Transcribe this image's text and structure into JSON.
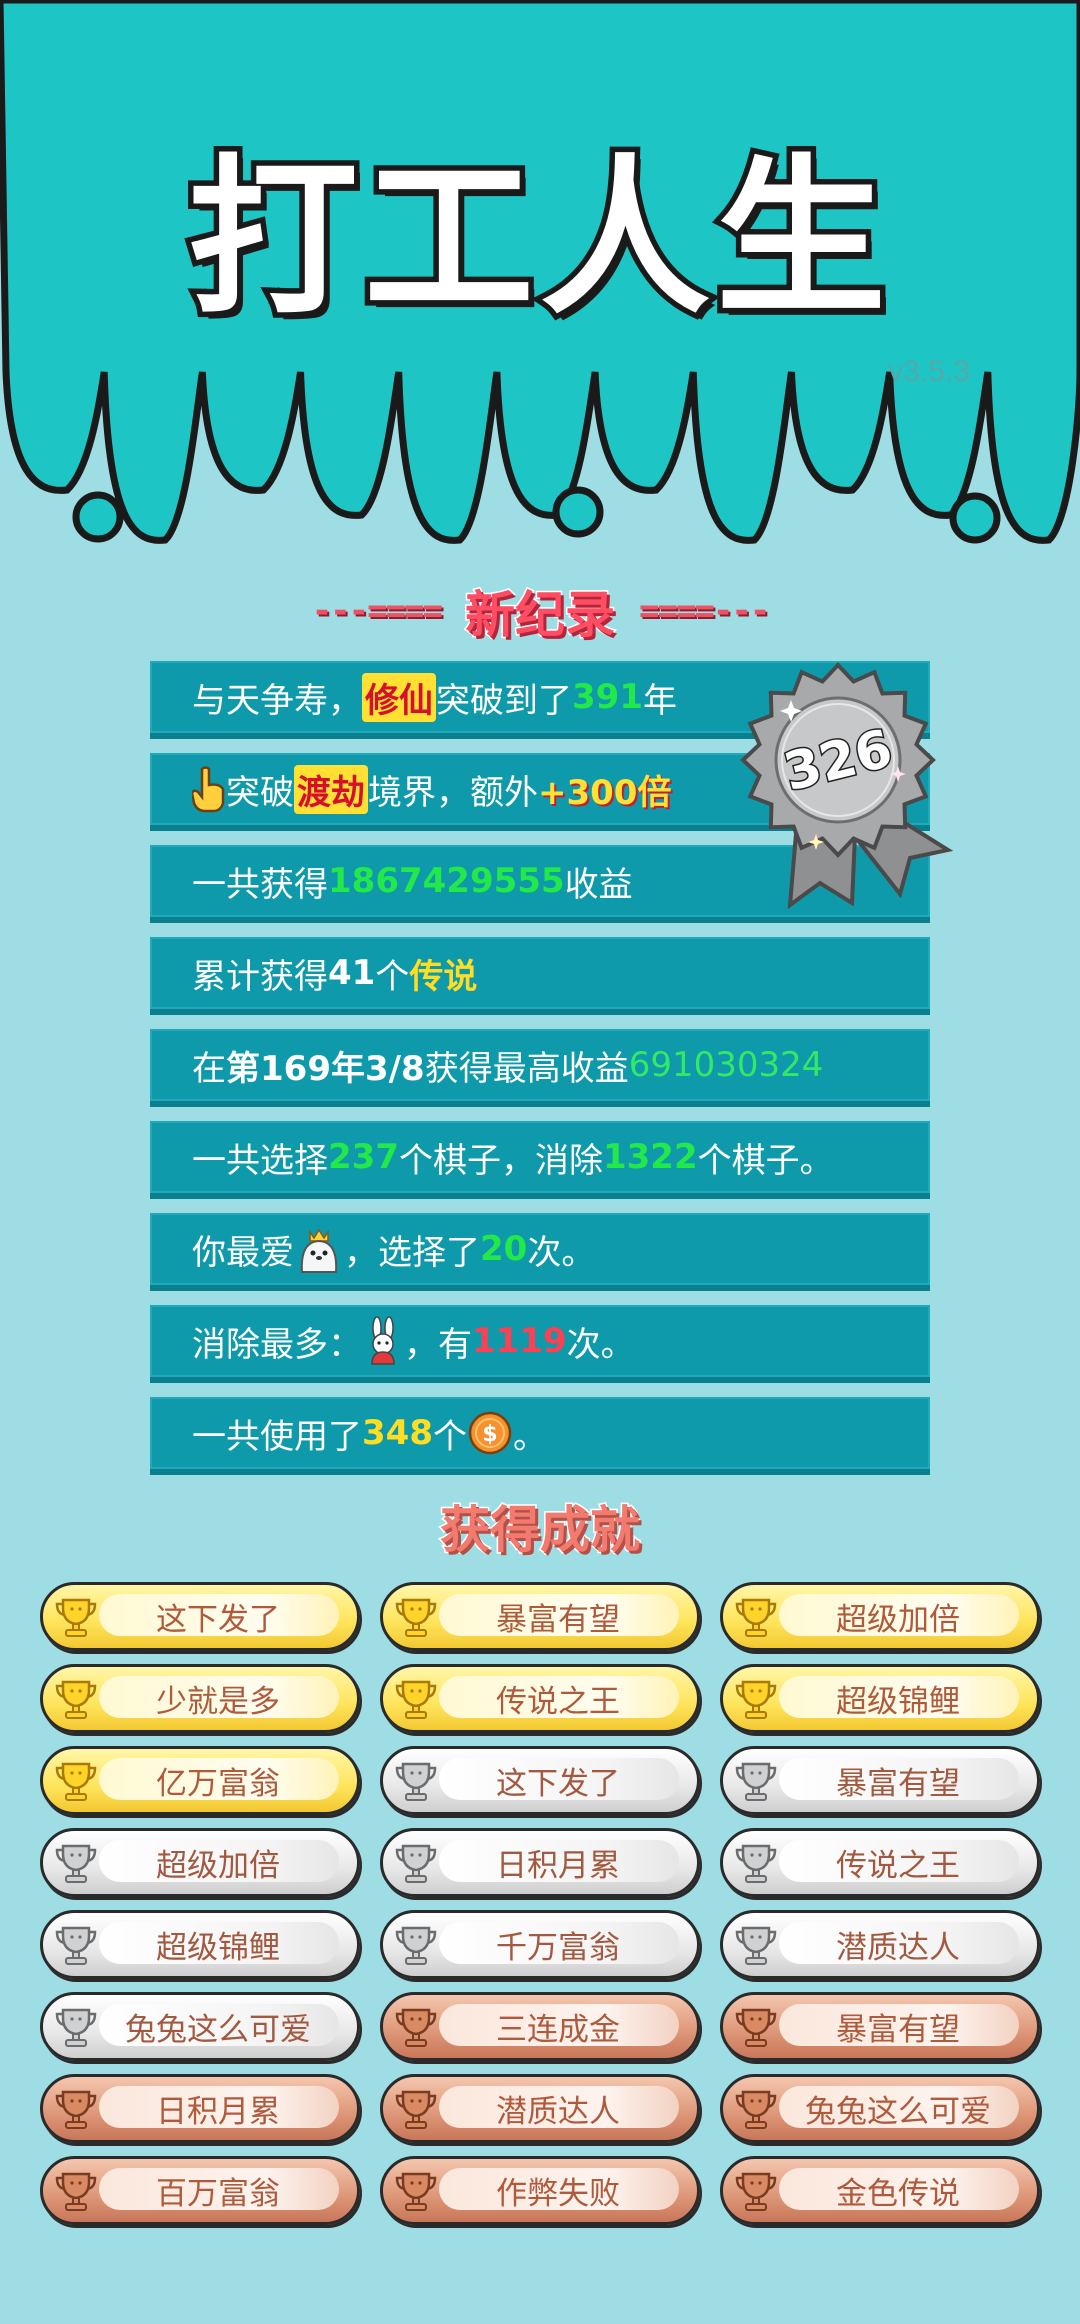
{
  "header": {
    "title": "打工人生",
    "version": "v3.5.3"
  },
  "colors": {
    "header_teal": "#1dc6c4",
    "background": "#9fdde5",
    "stat_row": "#0e9aaa",
    "accent_green": "#22e84a",
    "accent_red": "#ff3f52",
    "accent_yellow": "#ffdd22"
  },
  "record": {
    "left_dashes": "---====",
    "title": "新纪录",
    "right_dashes": "====---"
  },
  "badge": {
    "number": "326",
    "icon": "silver-rosette-icon"
  },
  "stats": {
    "row1": {
      "a": "与天争寿，",
      "b": "修仙",
      "c": "突破到了",
      "d": "391",
      "e": "年"
    },
    "row2": {
      "icon": "pointing-hand-icon",
      "a": "突破",
      "b": "渡劫",
      "c": "境界，额外",
      "d": "+300倍"
    },
    "row3": {
      "a": "一共获得",
      "b": "1867429555",
      "c": "收益"
    },
    "row4": {
      "a": "累计获得",
      "b": "41",
      "c": "个",
      "d": "传说"
    },
    "row5": {
      "a": "在 ",
      "b": "第169年3/8",
      "c": " 获得最高收益",
      "d": "691030324"
    },
    "row6": {
      "a": "一共选择",
      "b": "237",
      "c": "个棋子，消除",
      "d": "1322",
      "e": "个棋子。"
    },
    "row7": {
      "a": "你最爱",
      "icon": "crowned-seal-icon",
      "b": "，选择了",
      "c": "20",
      "d": "次。"
    },
    "row8": {
      "a": "消除最多：",
      "icon": "rabbit-icon",
      "b": "，有",
      "c": "1119",
      "d": "次。"
    },
    "row9": {
      "a": "一共使用了",
      "b": "348",
      "c": "个",
      "icon": "coin-icon",
      "d": "。"
    }
  },
  "achievements": {
    "title": "获得成就",
    "items": [
      {
        "label": "这下发了",
        "tier": "gold"
      },
      {
        "label": "暴富有望",
        "tier": "gold"
      },
      {
        "label": "超级加倍",
        "tier": "gold"
      },
      {
        "label": "少就是多",
        "tier": "gold"
      },
      {
        "label": "传说之王",
        "tier": "gold"
      },
      {
        "label": "超级锦鲤",
        "tier": "gold"
      },
      {
        "label": "亿万富翁",
        "tier": "gold"
      },
      {
        "label": "这下发了",
        "tier": "silver"
      },
      {
        "label": "暴富有望",
        "tier": "silver"
      },
      {
        "label": "超级加倍",
        "tier": "silver"
      },
      {
        "label": "日积月累",
        "tier": "silver"
      },
      {
        "label": "传说之王",
        "tier": "silver"
      },
      {
        "label": "超级锦鲤",
        "tier": "silver"
      },
      {
        "label": "千万富翁",
        "tier": "silver"
      },
      {
        "label": "潜质达人",
        "tier": "silver"
      },
      {
        "label": "兔兔这么可爱",
        "tier": "silver"
      },
      {
        "label": "三连成金",
        "tier": "bronze"
      },
      {
        "label": "暴富有望",
        "tier": "bronze"
      },
      {
        "label": "日积月累",
        "tier": "bronze"
      },
      {
        "label": "潜质达人",
        "tier": "bronze"
      },
      {
        "label": "兔兔这么可爱",
        "tier": "bronze"
      },
      {
        "label": "百万富翁",
        "tier": "bronze"
      },
      {
        "label": "作弊失败",
        "tier": "bronze"
      },
      {
        "label": "金色传说",
        "tier": "bronze"
      }
    ]
  }
}
